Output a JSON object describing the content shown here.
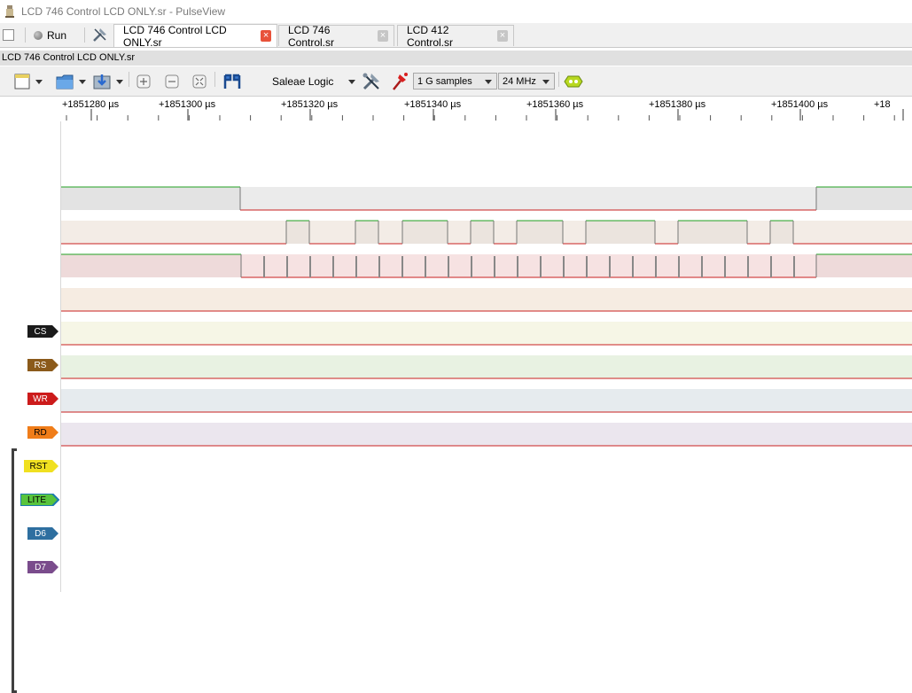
{
  "window": {
    "title": "LCD 746 Control LCD ONLY.sr - PulseView"
  },
  "toolbar_top": {
    "run_label": "Run"
  },
  "tabs": [
    {
      "label": "LCD 746 Control LCD ONLY.sr",
      "active": true
    },
    {
      "label": "LCD 746 Control.sr",
      "active": false
    },
    {
      "label": "LCD 412 Control.sr",
      "active": false
    }
  ],
  "session_path": "LCD 746 Control LCD ONLY.sr",
  "device": {
    "name": "Saleae Logic"
  },
  "samples": {
    "value": "1 G samples"
  },
  "samplerate": {
    "value": "24 MHz"
  },
  "ruler": {
    "labels": [
      "+1851280 µs",
      "+1851300 µs",
      "+1851320 µs",
      "+1851340 µs",
      "+1851360 µs",
      "+1851380 µs",
      "+1851400 µs",
      "+18"
    ]
  },
  "channels": [
    {
      "name": "CS",
      "color": "#1a1a1a"
    },
    {
      "name": "RS",
      "color": "#8b5a1a"
    },
    {
      "name": "WR",
      "color": "#cc1b1b"
    },
    {
      "name": "RD",
      "color": "#f07d19"
    },
    {
      "name": "RST",
      "color": "#f0e020"
    },
    {
      "name": "LITE",
      "color": "#58c43c"
    },
    {
      "name": "D6",
      "color": "#2e6fa0"
    },
    {
      "name": "D7",
      "color": "#7a4c8c"
    }
  ],
  "icons": [
    "pulseview-icon",
    "checkbox-icon",
    "run-icon",
    "probe-icon",
    "new-session-icon",
    "open-icon",
    "save-icon",
    "zoom-in-icon",
    "zoom-out-icon",
    "zoom-fit-icon",
    "cursor-icon",
    "device-config-icon",
    "probe-trigger-icon",
    "decoder-icon"
  ]
}
